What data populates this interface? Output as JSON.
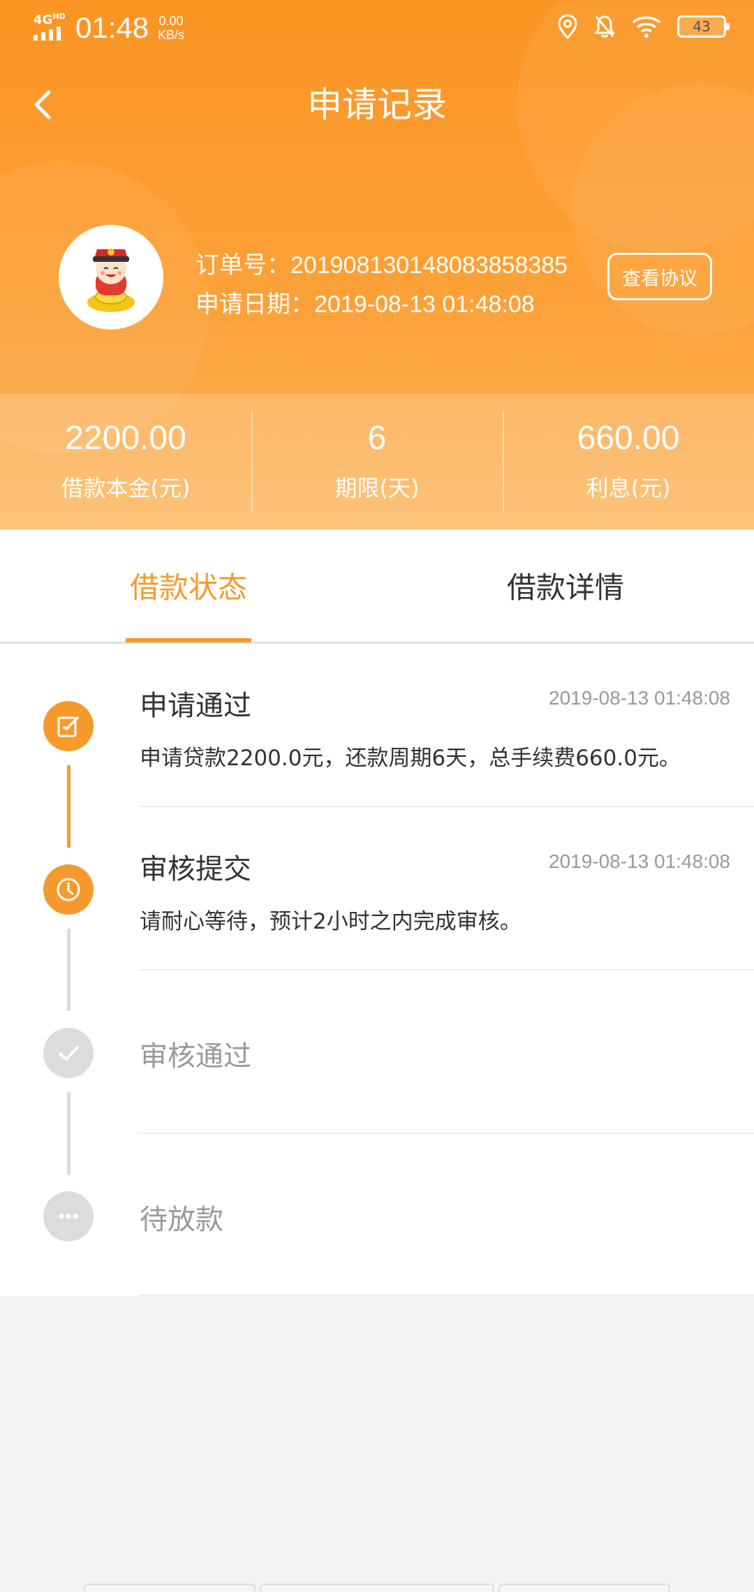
{
  "status_bar": {
    "network": "4G",
    "network_sup": "HD",
    "time": "01:48",
    "speed_value": "0.00",
    "speed_unit": "KB/s",
    "battery": "43",
    "icons": [
      "location-icon",
      "bell-off-icon",
      "wifi-icon",
      "battery-icon"
    ]
  },
  "header": {
    "title": "申请记录",
    "back_icon": "chevron-left-icon",
    "order_number": "订单号：2019081301480838583​85",
    "apply_date": "申请日期：2019-08-13 01:48:08",
    "agreement_button": "查看协议"
  },
  "stats": [
    {
      "value": "2200.00",
      "label": "借款本金(元)"
    },
    {
      "value": "6",
      "label": "期限(天)"
    },
    {
      "value": "660.00",
      "label": "利息(元)"
    }
  ],
  "tabs": [
    {
      "label": "借款状态",
      "active": true
    },
    {
      "label": "借款详情",
      "active": false
    }
  ],
  "timeline": [
    {
      "title": "申请通过",
      "time": "2019-08-13 01:48:08",
      "desc": "申请贷款2200.0元，还款周期6天，总手续费660.0元。",
      "done": true,
      "icon": "edit-icon"
    },
    {
      "title": "审核提交",
      "time": "2019-08-13 01:48:08",
      "desc": "请耐心等待，预计2小时之内完成审核。",
      "done": true,
      "icon": "clock-icon"
    },
    {
      "title": "审核通过",
      "time": "",
      "desc": "",
      "done": false,
      "icon": "check-icon"
    },
    {
      "title": "待放款",
      "time": "",
      "desc": "",
      "done": false,
      "icon": "more-icon"
    }
  ],
  "colors": {
    "accent": "#f79a2d",
    "header_top": "#fb9523",
    "inactive": "#dcdcdc"
  }
}
